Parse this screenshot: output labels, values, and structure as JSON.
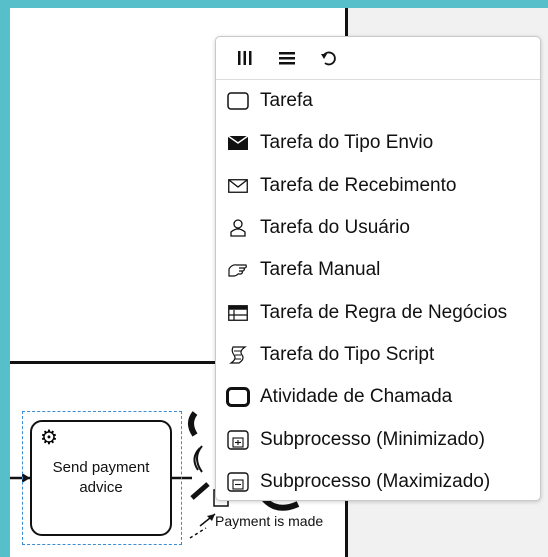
{
  "toolbar": {
    "icons": [
      "column-view-icon",
      "list-view-icon",
      "undo-icon"
    ]
  },
  "menu": {
    "items": [
      {
        "label": "Tarefa",
        "icon": "task-icon"
      },
      {
        "label": "Tarefa do Tipo Envio",
        "icon": "send-envelope-icon"
      },
      {
        "label": "Tarefa de Recebimento",
        "icon": "receive-envelope-icon"
      },
      {
        "label": "Tarefa do Usuário",
        "icon": "user-icon"
      },
      {
        "label": "Tarefa Manual",
        "icon": "hand-icon"
      },
      {
        "label": "Tarefa de Regra de Negócios",
        "icon": "business-rule-icon"
      },
      {
        "label": "Tarefa do Tipo Script",
        "icon": "script-icon"
      },
      {
        "label": "Atividade de Chamada",
        "icon": "call-activity-icon"
      },
      {
        "label": "Subprocesso (Minimizado)",
        "icon": "subprocess-collapsed-icon"
      },
      {
        "label": "Subprocesso (Maximizado)",
        "icon": "subprocess-expanded-icon"
      }
    ]
  },
  "diagram": {
    "task_label_line1": "Send payment",
    "task_label_line2": "advice",
    "event_label": "Payment is made"
  }
}
